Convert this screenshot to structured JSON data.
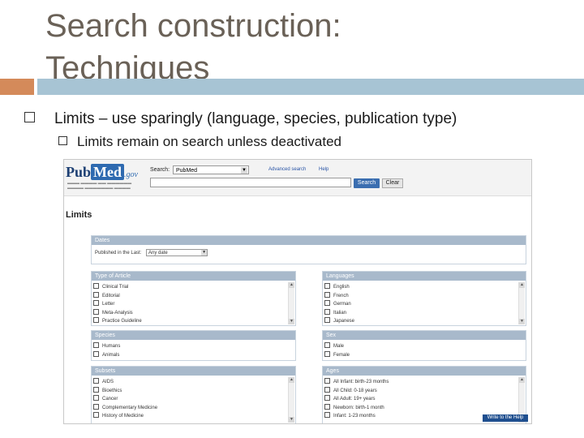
{
  "slide": {
    "title_line1": "Search construction:",
    "title_line2": "Techniques",
    "bullet1": "Limits – use sparingly (language, species, publication type)",
    "bullet2": "Limits remain on search unless deactivated"
  },
  "pubmed": {
    "logo_pub": "Pub",
    "logo_med": "Med",
    "logo_gov": ".gov",
    "search_label": "Search:",
    "db_value": "PubMed",
    "advanced_link": "Advanced search",
    "help_link": "Help",
    "search_button": "Search",
    "clear_button": "Clear",
    "limits_heading": "Limits",
    "dates": {
      "header": "Dates",
      "label": "Published in the Last:",
      "value": "Any date"
    },
    "type_of_article": {
      "header": "Type of Article",
      "items": [
        "Clinical Trial",
        "Editorial",
        "Letter",
        "Meta-Analysis",
        "Practice Guideline"
      ]
    },
    "languages": {
      "header": "Languages",
      "items": [
        "English",
        "French",
        "German",
        "Italian",
        "Japanese"
      ]
    },
    "species": {
      "header": "Species",
      "items": [
        "Humans",
        "Animals"
      ]
    },
    "sex": {
      "header": "Sex",
      "items": [
        "Male",
        "Female"
      ]
    },
    "subsets": {
      "header": "Subsets",
      "items": [
        "AIDS",
        "Bioethics",
        "Cancer",
        "Complementary Medicine",
        "History of Medicine"
      ]
    },
    "ages": {
      "header": "Ages",
      "items": [
        "All Infant: birth-23 months",
        "All Child: 0-18 years",
        "All Adult: 19+ years",
        "Newborn: birth-1 month",
        "Infant: 1-23 months"
      ]
    },
    "feedback": "Write to the Help Desk"
  }
}
